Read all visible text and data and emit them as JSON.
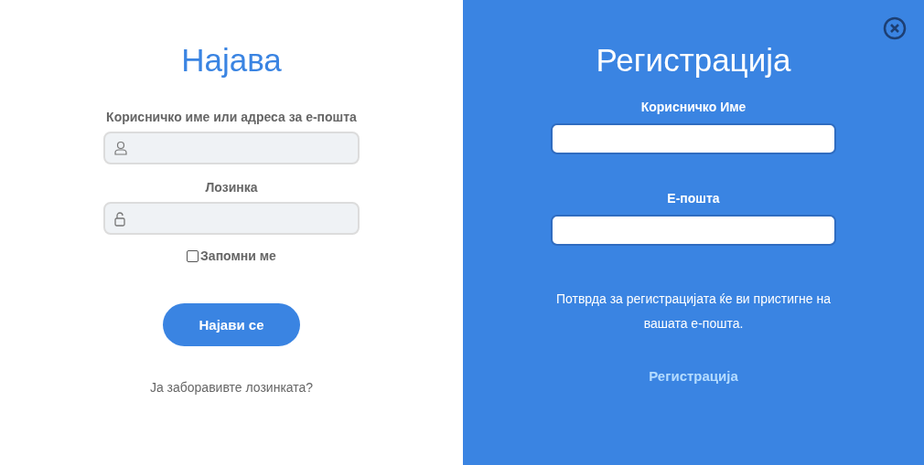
{
  "login": {
    "title": "Најава",
    "fields": [
      {
        "label": "Корисничко име или адреса за е-пошта",
        "kind": "user"
      },
      {
        "label": "Лозинка",
        "kind": "lock"
      }
    ],
    "remember": {
      "label": "Запомни ме",
      "checked": false
    },
    "button": "Најави се",
    "forgot": "Ја заборавивте лозинката?"
  },
  "register": {
    "title": "Регистрација",
    "fields": [
      {
        "label": "Корисничко Име"
      },
      {
        "label": "Е-пошта"
      }
    ],
    "note": "Потврда за регистрацијата ќе ви пристигне на вашата е-пошта.",
    "button": "Регистрација"
  }
}
